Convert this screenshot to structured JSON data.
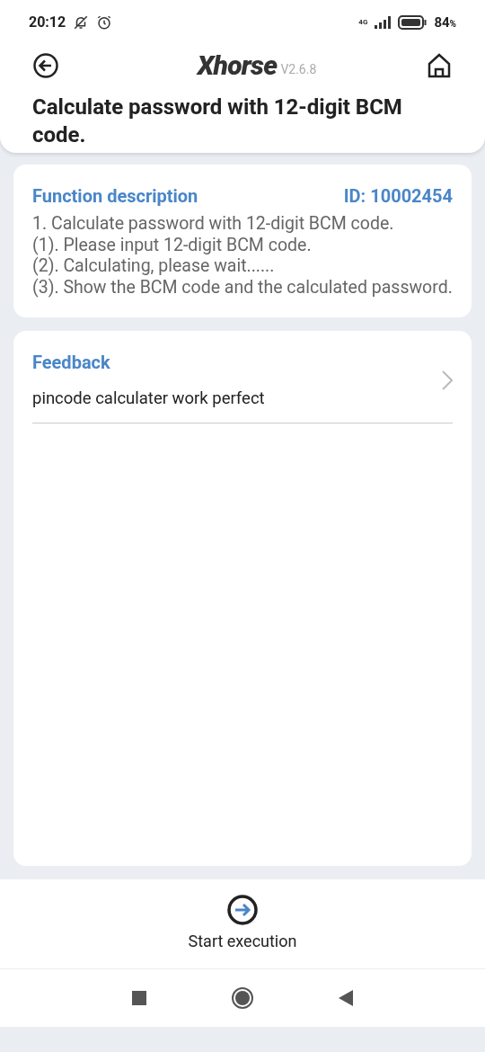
{
  "status_bar": {
    "time": "20:12",
    "network": "4G",
    "battery": "84",
    "battery_unit": "%"
  },
  "header": {
    "logo": "Xhorse",
    "version": "V2.6.8",
    "title": "Calculate password with 12-digit BCM code."
  },
  "description": {
    "heading": "Function description",
    "id": "ID: 10002454",
    "lines": [
      "1. Calculate password with 12-digit BCM code.",
      "(1). Please input 12-digit BCM code.",
      "(2). Calculating, please wait......",
      "(3). Show the BCM code and the calculated password."
    ]
  },
  "feedback": {
    "heading": "Feedback",
    "text": "pincode calculater work perfect"
  },
  "action": {
    "label": "Start execution"
  }
}
